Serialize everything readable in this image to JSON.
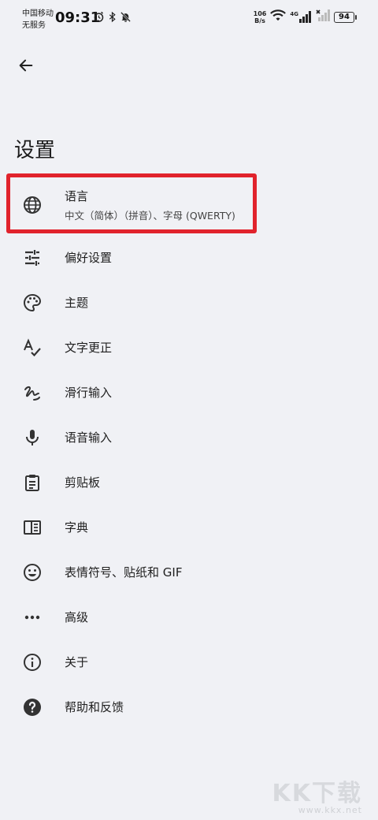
{
  "status_bar": {
    "carrier_top": "中国移动",
    "carrier_bottom": "无服务",
    "time": "09:31",
    "net_speed_value": "106",
    "net_speed_unit": "B/s",
    "network_type": "4G",
    "battery": "94"
  },
  "header": {
    "title": "设置"
  },
  "menu": {
    "items": [
      {
        "label": "语言",
        "sub": "中文（简体）（拼音）、字母 (QWERTY)",
        "icon": "globe-icon"
      },
      {
        "label": "偏好设置",
        "icon": "tune-icon"
      },
      {
        "label": "主题",
        "icon": "palette-icon"
      },
      {
        "label": "文字更正",
        "icon": "spellcheck-icon"
      },
      {
        "label": "滑行输入",
        "icon": "gesture-icon"
      },
      {
        "label": "语音输入",
        "icon": "microphone-icon"
      },
      {
        "label": "剪贴板",
        "icon": "clipboard-icon"
      },
      {
        "label": "字典",
        "icon": "dictionary-icon"
      },
      {
        "label": "表情符号、贴纸和 GIF",
        "icon": "emoji-icon"
      },
      {
        "label": "高级",
        "icon": "more-horiz-icon"
      },
      {
        "label": "关于",
        "icon": "info-icon"
      },
      {
        "label": "帮助和反馈",
        "icon": "help-icon"
      }
    ]
  },
  "watermark": {
    "logo": "KK下载",
    "url": "www.kkx.net"
  },
  "colors": {
    "background": "#f0f1f5",
    "highlight": "#e1232c",
    "icon": "#333333"
  }
}
